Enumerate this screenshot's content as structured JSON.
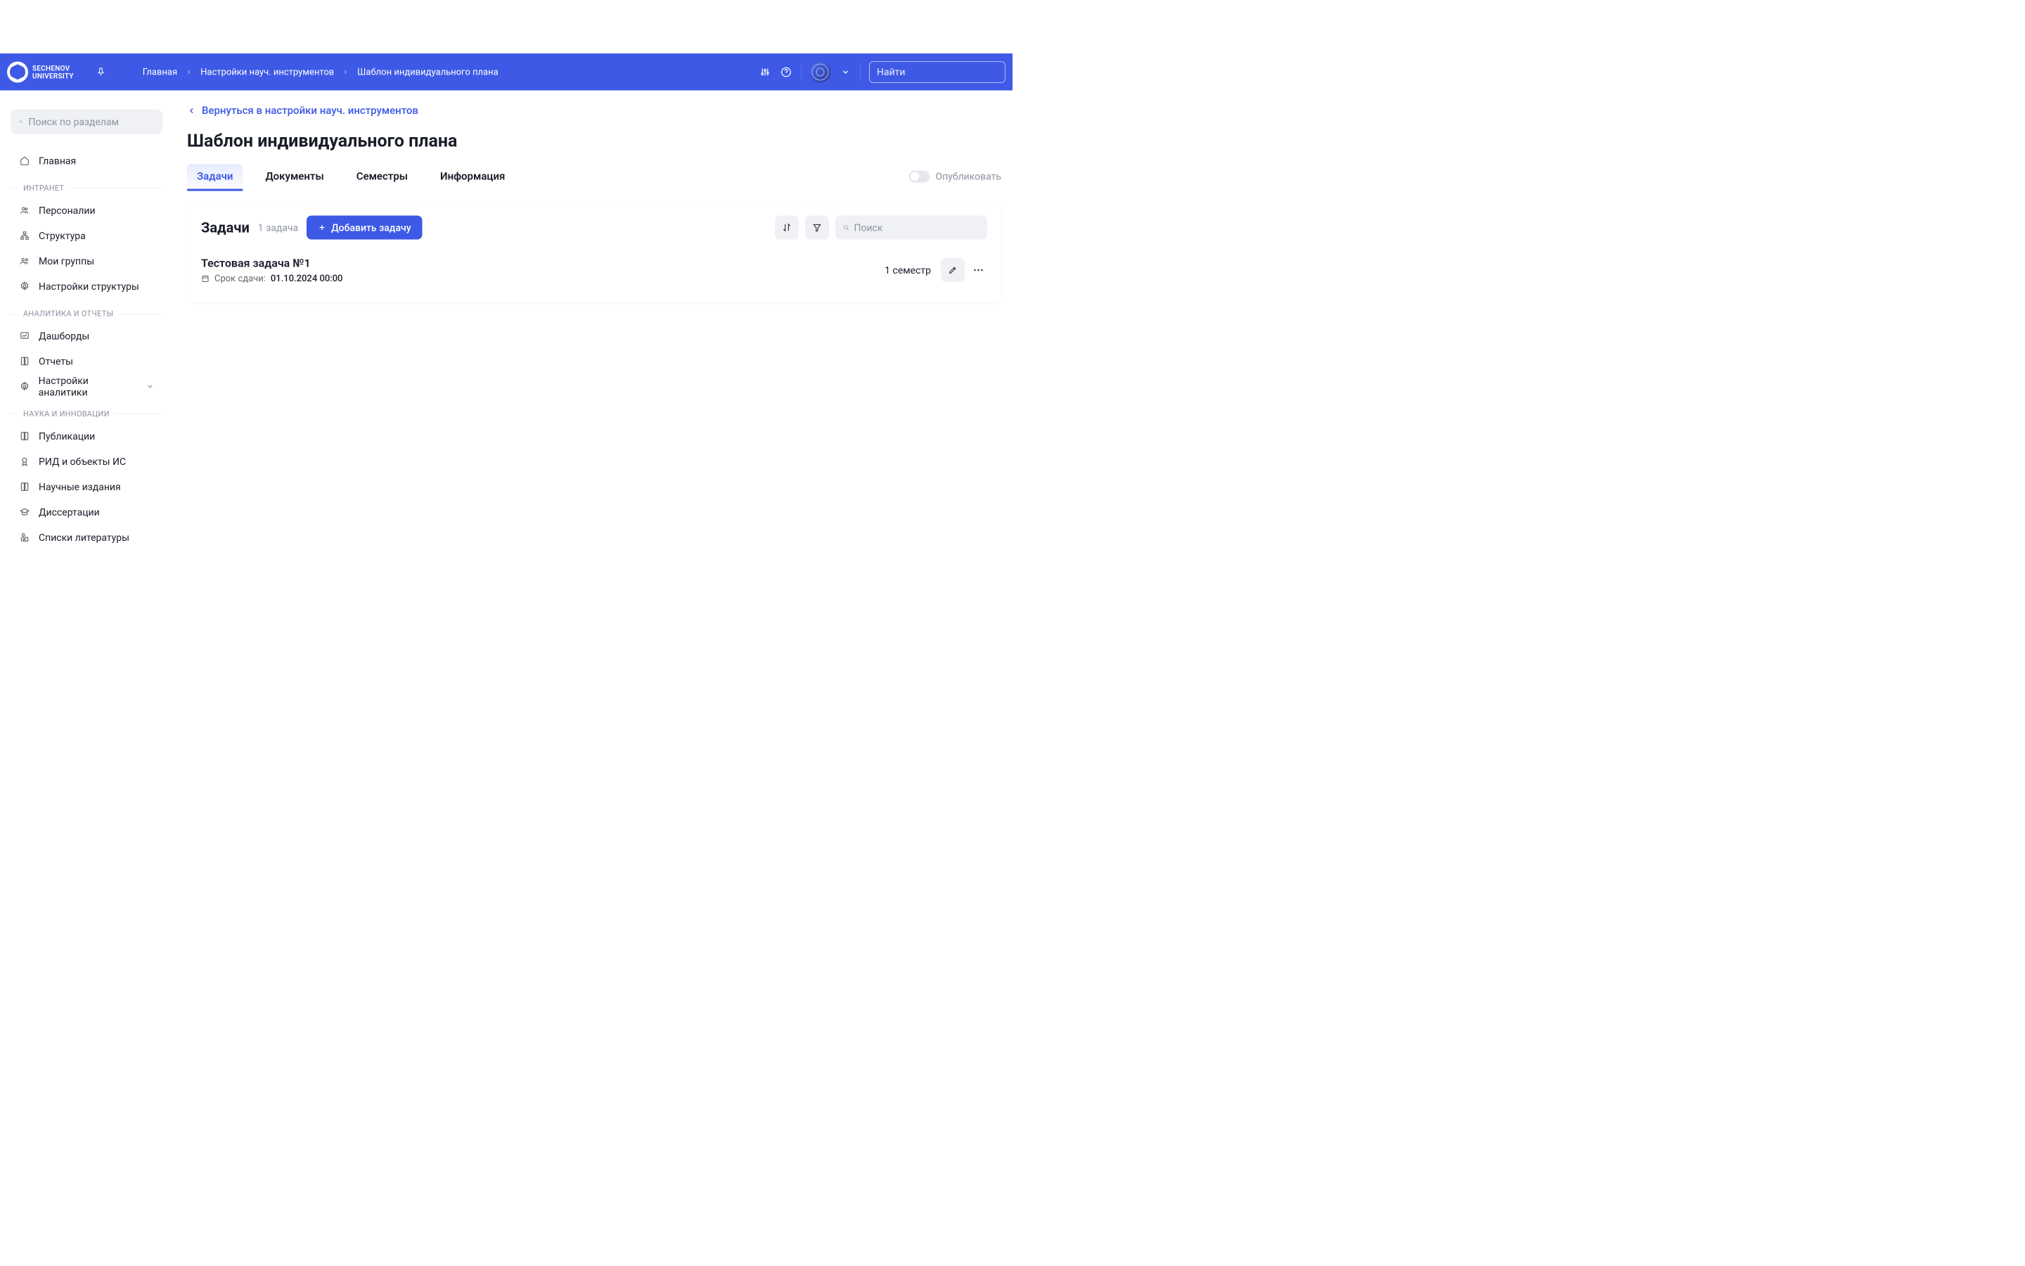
{
  "header": {
    "logo_line1": "SECHENOV",
    "logo_line2": "UNIVERSITY",
    "breadcrumb": [
      "Главная",
      "Настройки науч. инструментов",
      "Шаблон индивидуального плана"
    ],
    "search_placeholder": "Найти"
  },
  "sidebar": {
    "search_placeholder": "Поиск по разделам",
    "home": "Главная",
    "sections": [
      {
        "title": "ИНТРАНЕТ",
        "items": [
          "Персоналии",
          "Структура",
          "Мои группы",
          "Настройки структуры"
        ]
      },
      {
        "title": "АНАЛИТИКА И ОТЧЕТЫ",
        "items": [
          "Дашборды",
          "Отчеты",
          "Настройки аналитики"
        ]
      },
      {
        "title": "НАУКА И ИННОВАЦИИ",
        "items": [
          "Публикации",
          "РИД и объекты ИС",
          "Научные издания",
          "Диссертации",
          "Списки литературы"
        ]
      }
    ]
  },
  "main": {
    "back_label": "Вернуться в настройки науч. инструментов",
    "title": "Шаблон индивидуального плана",
    "tabs": [
      "Задачи",
      "Документы",
      "Семестры",
      "Информация"
    ],
    "publish_label": "Опубликовать",
    "card": {
      "title": "Задачи",
      "count": "1 задача",
      "add_label": "Добавить задачу",
      "search_placeholder": "Поиск",
      "tasks": [
        {
          "name": "Тестовая задача №1",
          "deadline_label": "Срок сдачи:",
          "deadline": "01.10.2024 00:00",
          "semester": "1 семестр"
        }
      ]
    }
  }
}
